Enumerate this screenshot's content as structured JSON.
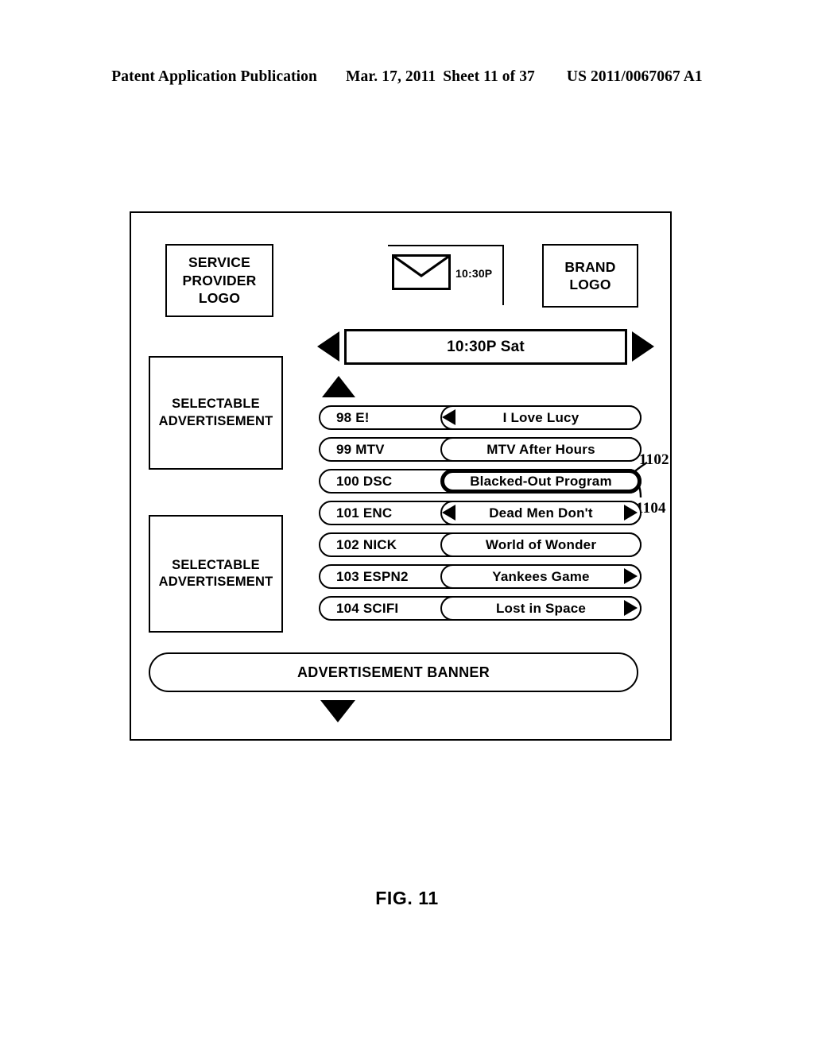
{
  "header": {
    "publication": "Patent Application Publication",
    "date": "Mar. 17, 2011",
    "sheet": "Sheet 11 of 37",
    "patent_number": "US 2011/0067067 A1"
  },
  "figure": {
    "caption": "FIG. 11"
  },
  "screen": {
    "service_provider_logo": "SERVICE PROVIDER LOGO",
    "brand_logo": "BRAND LOGO",
    "mail_indicator": {
      "icon": "envelope-icon",
      "time": "10:30P"
    },
    "time_bar": {
      "value": "10:30P Sat",
      "prev_icon": "triangle-left-icon",
      "next_icon": "triangle-right-icon"
    },
    "scroll_up_icon": "triangle-up-icon",
    "scroll_down_icon": "triangle-down-icon",
    "ads": [
      {
        "label": "SELECTABLE ADVERTISEMENT"
      },
      {
        "label": "SELECTABLE ADVERTISEMENT"
      }
    ],
    "ad_banner": "ADVERTISEMENT BANNER",
    "grid_rows": [
      {
        "channel": "98 E!",
        "program": "I Love Lucy",
        "left_arrow": true,
        "right_arrow": false,
        "highlighted": false
      },
      {
        "channel": "99 MTV",
        "program": "MTV After Hours",
        "left_arrow": false,
        "right_arrow": false,
        "highlighted": false
      },
      {
        "channel": "100 DSC",
        "program": "Blacked-Out Program",
        "left_arrow": false,
        "right_arrow": false,
        "highlighted": true
      },
      {
        "channel": "101 ENC",
        "program": "Dead Men Don't",
        "left_arrow": true,
        "right_arrow": true,
        "highlighted": false
      },
      {
        "channel": "102 NICK",
        "program": "World of Wonder",
        "left_arrow": false,
        "right_arrow": false,
        "highlighted": false
      },
      {
        "channel": "103 ESPN2",
        "program": "Yankees Game",
        "left_arrow": false,
        "right_arrow": true,
        "highlighted": false
      },
      {
        "channel": "104 SCIFI",
        "program": "Lost in Space",
        "left_arrow": false,
        "right_arrow": true,
        "highlighted": false
      }
    ]
  },
  "callouts": [
    {
      "label": "1102"
    },
    {
      "label": "1104"
    }
  ]
}
